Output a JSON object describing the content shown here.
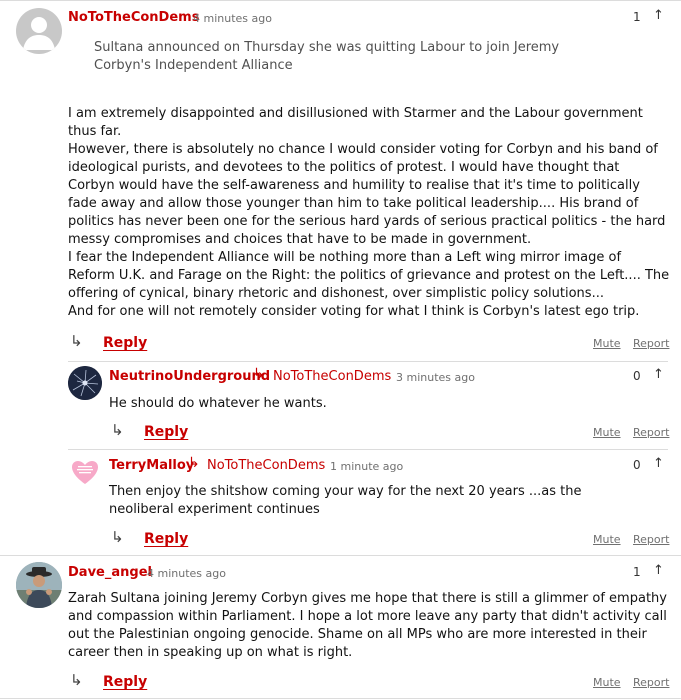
{
  "comments": [
    {
      "username": "NoToTheConDems",
      "time": "4 minutes ago",
      "count": "1",
      "quote": "Sultana announced on Thursday she was quitting Labour to join Jeremy Corbyn's Independent Alliance",
      "paragraphs": [
        "I am extremely disappointed and disillusioned with Starmer and the Labour government thus far.",
        "However, there is absolutely no chance I would consider voting for Corbyn and his band of ideological purists, and devotees to the politics of protest. I would have thought that Corbyn would have the self-awareness and humility to realise that it's time to politically fade away and allow those younger than him to take political leadership.... His brand of politics has never been one for the serious hard yards of serious practical politics - the hard messy compromises and choices that have to be made in government.",
        "I fear the Independent Alliance will be nothing more than a Left wing mirror image of Reform U.K. and Farage on the Right: the politics of grievance and protest on the Left.... The offering of cynical, binary rhetoric and dishonest, over simplistic policy solutions...",
        "And for one will not remotely consider voting for what I think is Corbyn's latest ego trip."
      ]
    },
    {
      "username": "NeutrinoUnderground",
      "reply_to": "NoToTheConDems",
      "time": "3 minutes ago",
      "count": "0",
      "text": "He should do whatever he wants."
    },
    {
      "username": "TerryMalloy",
      "reply_to": "NoToTheConDems",
      "time": "1 minute ago",
      "count": "0",
      "text": "Then enjoy the shitshow coming your way for the next 20 years ...as the neoliberal experiment continues"
    },
    {
      "username": "Dave_angel",
      "time": "4 minutes ago",
      "count": "1",
      "text": "Zarah Sultana joining Jeremy Corbyn gives me hope that there is still a glimmer of empathy and compassion within Parliament. I hope a lot more leave any party that didn't activity call out the Palestinian ongoing genocide. Shame on all MPs who are more interested in their career then in speaking up on what is right."
    }
  ],
  "actions": {
    "reply": "Reply",
    "mute": "Mute",
    "report": "Report",
    "reply_arrow": "↳",
    "upvote": "↑"
  },
  "colors": {
    "username": "#c70000",
    "text": "#121212",
    "muted": "#707070",
    "divider": "#dcdcdc"
  },
  "icons": {
    "reply_arrow": "reply-arrow-icon",
    "upvote": "upvote-arrow-icon",
    "reply_to": "reply-to-arrow-icon"
  }
}
